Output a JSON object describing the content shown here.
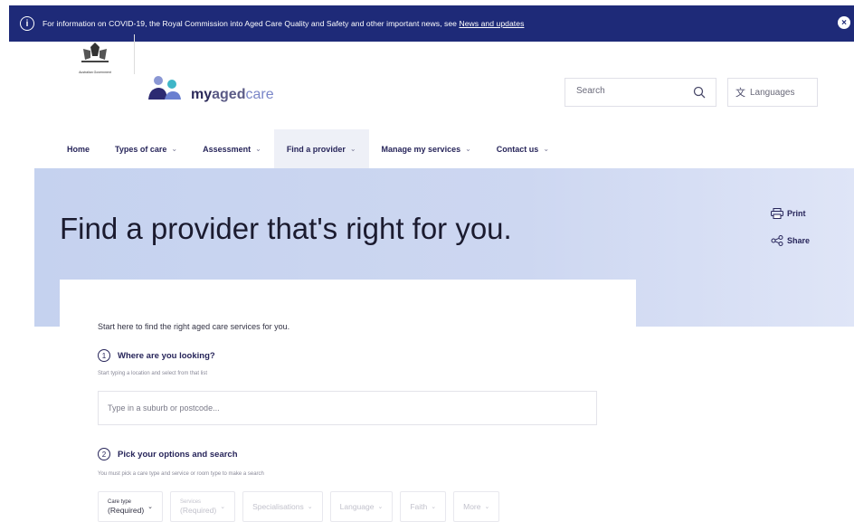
{
  "alert": {
    "text": "For information on COVID-19, the Royal Commission into Aged Care Quality and Safety and other important news, see ",
    "link": "News and updates",
    "info_icon": "info-icon",
    "close_icon": "close-icon"
  },
  "header": {
    "gov_label": "Australian Government",
    "logo": {
      "my": "my",
      "aged": "aged",
      "care": "care"
    },
    "search": {
      "placeholder": "Search",
      "icon": "search-icon"
    },
    "languages": {
      "label": "Languages",
      "icon": "translate-icon"
    }
  },
  "nav": {
    "items": [
      {
        "label": "Home",
        "dropdown": false,
        "active": false
      },
      {
        "label": "Types of care",
        "dropdown": true,
        "active": false
      },
      {
        "label": "Assessment",
        "dropdown": true,
        "active": false
      },
      {
        "label": "Find a provider",
        "dropdown": true,
        "active": true
      },
      {
        "label": "Manage my services",
        "dropdown": true,
        "active": false
      },
      {
        "label": "Contact us",
        "dropdown": true,
        "active": false
      }
    ]
  },
  "hero": {
    "title": "Find a provider that's right for you.",
    "print": "Print",
    "share": "Share"
  },
  "form": {
    "intro": "Start here to find the right aged care services for you.",
    "step1": {
      "number": "1",
      "title": "Where are you looking?",
      "helper": "Start typing a location and select from that list",
      "placeholder": "Type in a suburb or postcode..."
    },
    "step2": {
      "number": "2",
      "title": "Pick your options and search",
      "helper": "You must pick a care type and service or room type to make a search",
      "filters": [
        {
          "label": "Care type",
          "sub": "(Required)"
        },
        {
          "label": "Services",
          "sub": "(Required)"
        },
        {
          "label": "Specialisations"
        },
        {
          "label": "Language"
        },
        {
          "label": "Faith"
        },
        {
          "label": "More"
        }
      ]
    }
  },
  "colors": {
    "banner": "#1e2a78",
    "nav_text": "#27255a",
    "hero_bg": "#c9d4f0",
    "active_nav_bg": "#eef0f7"
  }
}
